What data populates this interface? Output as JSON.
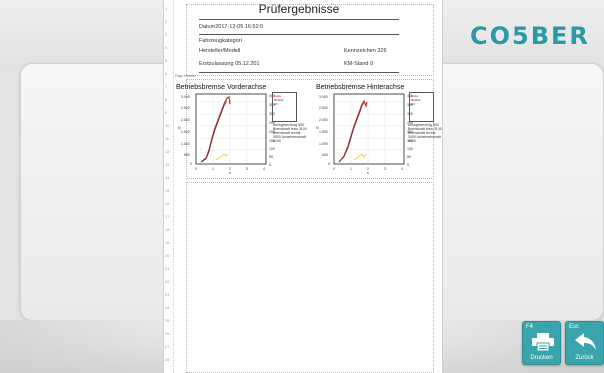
{
  "brand": {
    "logo_text": "CO5BER",
    "color": "#2a9aa6"
  },
  "report": {
    "title": "Prüfergebnisse",
    "datum": "Datum2017-12-05  16:52:0",
    "fahrzeugkategorie": "Fahrzeugkategori",
    "hersteller_modell": "Hersteller/Modell",
    "kennzeichen": "Kennzeichen  326",
    "erstzulassung": "Erstzulassung  05.12.201",
    "km_stand": "KM-Stand  0",
    "page_header": "Page Header",
    "ruler_numbers": [
      "1",
      "2",
      "3",
      "4",
      "5",
      "6",
      "7",
      "8",
      "9",
      "10",
      "11",
      "12",
      "13",
      "14",
      "15",
      "16",
      "17",
      "18",
      "19",
      "20",
      "21",
      "22",
      "23",
      "24",
      "25",
      "26",
      "27",
      "28"
    ]
  },
  "charts": [
    {
      "title": "Betriebsbremse Vorderachse",
      "y_ticks": [
        "3.000",
        "2.500",
        "2.000",
        "1.500",
        "1.000",
        "500",
        "0"
      ],
      "y2_ticks": [
        "400",
        "350",
        "300",
        "250",
        "200",
        "150",
        "100",
        "50",
        "0"
      ],
      "x_ticks": [
        "0",
        "1",
        "2",
        "3",
        "4"
      ],
      "y_unit": "N",
      "x_unit": "s",
      "legend": [
        "Links",
        "Rechts",
        "kN"
      ],
      "notes": "Achsgewicht:kg 800 Bremskraft links 3100 Bremskraft rechts 3000 Achsbremskraft 6100"
    },
    {
      "title": "Betriebsbremse Hinterachse",
      "y_ticks": [
        "3.000",
        "2.500",
        "2.000",
        "1.500",
        "1.000",
        "500",
        "0"
      ],
      "y2_ticks": [
        "400",
        "350",
        "300",
        "250",
        "200",
        "150",
        "100",
        "50",
        "0"
      ],
      "x_ticks": [
        "0",
        "1",
        "2",
        "3",
        "4"
      ],
      "y_unit": "N",
      "x_unit": "s",
      "legend": [
        "Links",
        "Rechts",
        "kN"
      ],
      "notes": "Achsgewicht:kg 800 Bremskraft links 3100 Bremskraft rechts 3000 Achsbremskraft 6100"
    }
  ],
  "buttons": {
    "print": {
      "key": "F4",
      "label": "Drucken"
    },
    "back": {
      "key": "Esc",
      "label": "Zurück"
    }
  }
}
